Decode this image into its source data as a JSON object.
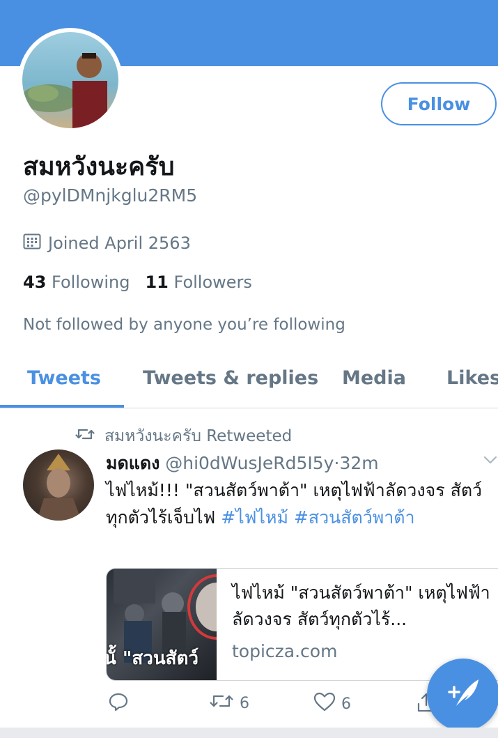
{
  "colors": {
    "accent": "#4a90e2",
    "secondary_text": "#657786",
    "primary_text": "#14171a"
  },
  "profile": {
    "display_name": "สมหวังนะครับ",
    "handle": "@pylDMnjkglu2RM5",
    "follow_label": "Follow",
    "joined": "Joined April 2563",
    "following_count": "43",
    "following_label": "Following",
    "followers_count": "11",
    "followers_label": "Followers",
    "not_followed_text": "Not followed by anyone you’re following"
  },
  "tabs": [
    {
      "label": "Tweets",
      "active": true
    },
    {
      "label": "Tweets & replies",
      "active": false
    },
    {
      "label": "Media",
      "active": false
    },
    {
      "label": "Likes",
      "active": false
    }
  ],
  "tweet": {
    "retweeted_by": "สมหวังนะครับ Retweeted",
    "author_name": "มดแดง",
    "author_handle": "@hi0dWusJeRd5I5y",
    "separator": "·",
    "time": "32m",
    "text_plain": "ไฟไหม้!!! \"สวนสัตว์พาต้า\" เหตุไฟฟ้าลัดวงจร สัตว์ทุกตัวไร้เจ็บไฟ",
    "hashtag_1": "#ไฟไหม้",
    "hashtag_2": "#สวนสัตว์พาต้า",
    "card": {
      "image_text": "นั้ \"สวนสัตว์",
      "title": "ไฟไหม้ \"สวนสัตว์พาต้า\" เหตุไฟฟ้าลัดวงจร สัตว์ทุกตัวไร้...",
      "domain": "topicza.com"
    },
    "actions": {
      "reply_icon": "reply-icon",
      "retweet_icon": "retweet-icon",
      "retweet_count": "6",
      "like_icon": "heart-icon",
      "like_count": "6",
      "share_icon": "share-icon"
    }
  },
  "fab_icon": "compose-tweet-icon"
}
